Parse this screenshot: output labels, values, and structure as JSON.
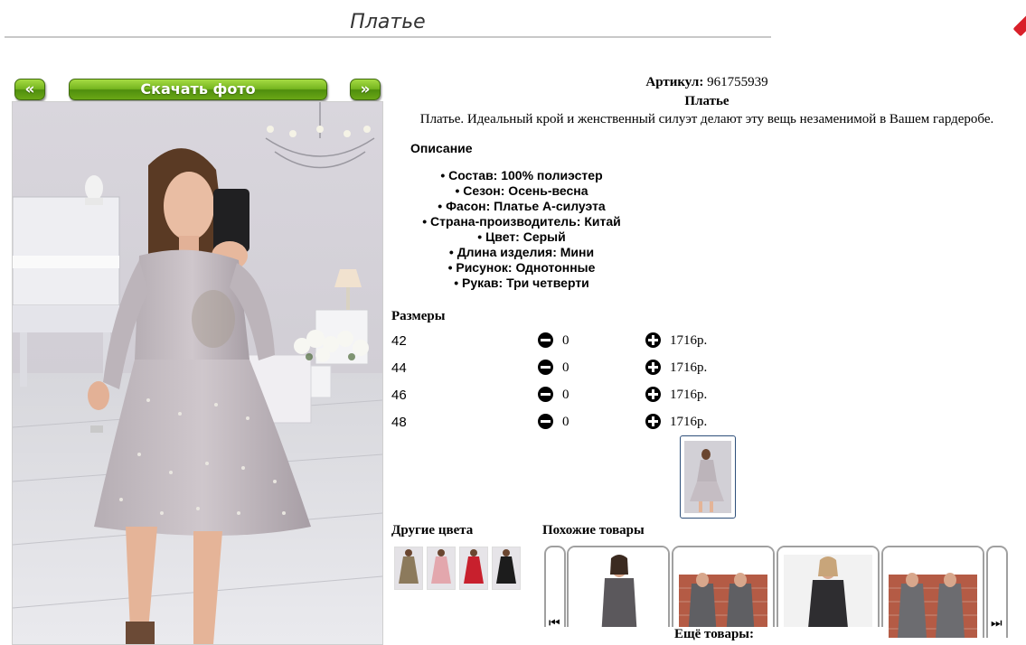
{
  "page": {
    "title": "Платье"
  },
  "nav": {
    "prev_label": "«",
    "download_label": "Скачать фото",
    "next_label": "»"
  },
  "product": {
    "article_label": "Артикул:",
    "article_number": "961755939",
    "name": "Платье",
    "tagline": "Платье. Идеальный крой и женственный силуэт делают эту вещь незаменимой в Вашем гардеробе.",
    "description_heading": "Описание",
    "attributes": [
      "Состав: 100% полиэстер",
      "Сезон: Осень-весна",
      "Фасон: Платье А-силуэта",
      "Страна-производитель: Китай",
      "Цвет: Серый",
      "Длина изделия: Мини",
      "Рисунок: Однотонные",
      "Рукав: Три четверти"
    ]
  },
  "sizes": {
    "heading": "Размеры",
    "rows": [
      {
        "size": "42",
        "qty": "0",
        "price": "1716р."
      },
      {
        "size": "44",
        "qty": "0",
        "price": "1716р."
      },
      {
        "size": "46",
        "qty": "0",
        "price": "1716р."
      },
      {
        "size": "48",
        "qty": "0",
        "price": "1716р."
      }
    ]
  },
  "other_colors": {
    "heading": "Другие цвета",
    "swatches": [
      "#8c7a5c",
      "#e3a7ad",
      "#c8202d",
      "#1c1c1c"
    ]
  },
  "similar": {
    "heading": "Похожие товары",
    "more_label": "Ещё товары:"
  },
  "icons": {
    "prev_arrow": "skip-back-icon",
    "next_arrow": "skip-forward-icon",
    "minus": "minus-circle-icon",
    "plus": "plus-circle-icon"
  },
  "colors": {
    "accent_green": "#75b51f",
    "dress_grey": "#bdb5b8"
  }
}
